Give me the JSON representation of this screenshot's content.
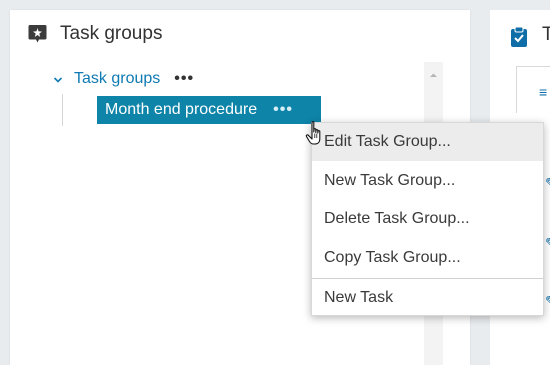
{
  "panel": {
    "title": "Task groups",
    "title_icon": "task-group-icon"
  },
  "tree": {
    "root_label": "Task groups",
    "root_more": "•••",
    "selected_label": "Month end procedure",
    "selected_more": "•••"
  },
  "right_panel": {
    "title_partial": "T",
    "icon": "clipboard-icon",
    "tab_icon": "≡"
  },
  "context_menu": {
    "items": [
      {
        "label": "Edit Task Group..."
      },
      {
        "label": "New Task Group..."
      },
      {
        "label": "Delete Task Group..."
      },
      {
        "label": "Copy Task Group..."
      },
      {
        "label": "New Task"
      }
    ]
  },
  "colors": {
    "accent": "#0e84a8",
    "link": "#0f7ab3",
    "menu_hover": "#ececec"
  }
}
